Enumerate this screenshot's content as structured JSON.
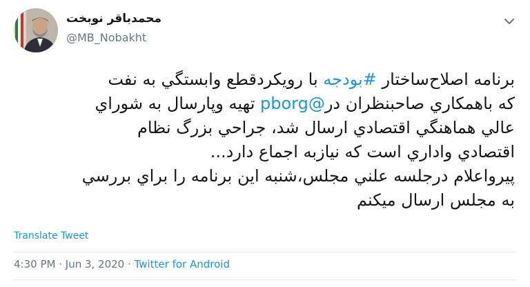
{
  "author": {
    "display_name": "محمدباقر نوبخت",
    "handle": "@MB_Nobakht"
  },
  "tweet": {
    "line1_prefix": "برنامه اصلاح‌ساختار ",
    "line1_hashtag": "#بودجه",
    "line1_suffix": " با رويكردقطع وابستگي به نفت",
    "line2_prefix": "كه باهمكاري صاحبنظران در",
    "line2_mention": "@pborg",
    "line2_suffix": " تهيه وپارسال به شوراي",
    "line3": "عالي هماهنگي اقتصادي ارسال شد، جراحي بزرگ نظام",
    "line4": "اقتصادي واداري است كه نيازبه اجماع دارد...",
    "line5": "پيرواعلام درجلسه علني مجلس،شنبه اين برنامه را براي بررسي",
    "line6": "به مجلس ارسال ميكنم"
  },
  "translate_label": "Translate Tweet",
  "meta": {
    "time": "4:30 PM",
    "separator": " · ",
    "date": "Jun 3, 2020",
    "source": "Twitter for Android"
  },
  "colors": {
    "link": "#1b95e0",
    "secondary_text": "#657786",
    "primary_text": "#14171a",
    "divider": "#e6ecf0"
  },
  "icons": {
    "menu": "chevron-down-icon",
    "profile": "avatar"
  }
}
